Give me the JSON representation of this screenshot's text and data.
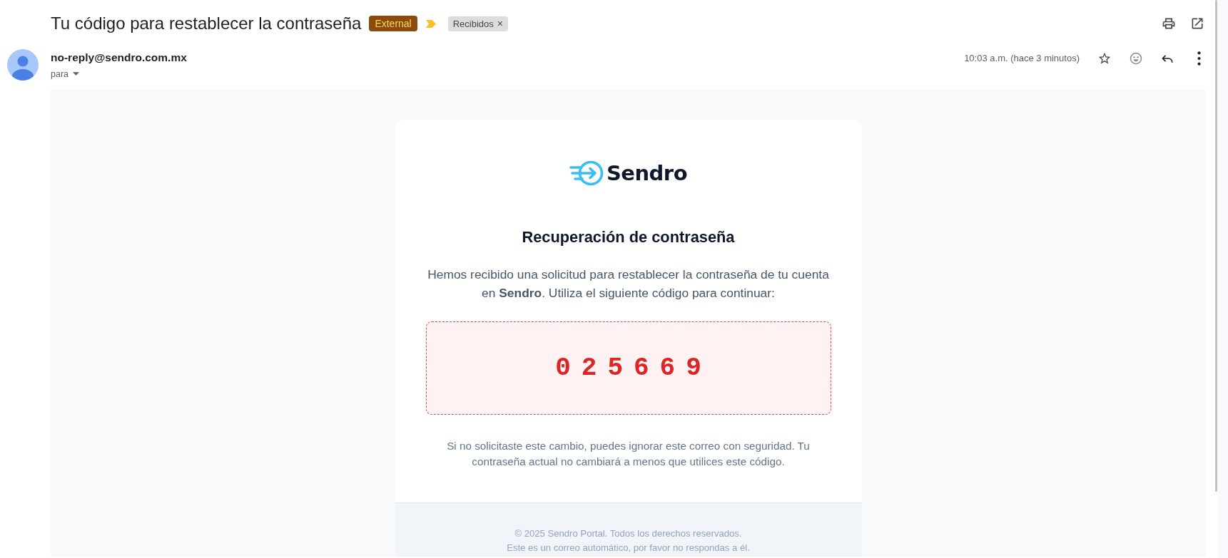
{
  "subject": {
    "title": "Tu código para restablecer la contraseña",
    "external_badge": "External",
    "important": true,
    "labels": [
      {
        "name": "Recibidos",
        "remove": "×"
      }
    ]
  },
  "message": {
    "sender": "no-reply@sendro.com.mx",
    "recipients_toggle": "para",
    "time": "10:03 a.m. (hace 3 minutos)",
    "starred": false
  },
  "email": {
    "brand": "Sendro",
    "heading": "Recuperación de contraseña",
    "intro": "Hemos recibido una solicitud para restablecer la contraseña de tu cuenta en **Sendro**. Utiliza el siguiente código para continuar:",
    "code": "025669",
    "notice": "Si no solicitaste este cambio, puedes ignorar este correo con seguridad. Tu contraseña actual no cambiará a menos que utilices este código.",
    "footer": [
      "© 2025 Sendro Portal. Todos los derechos reservados.",
      "Este es un correo automático, por favor no respondas a él."
    ]
  }
}
